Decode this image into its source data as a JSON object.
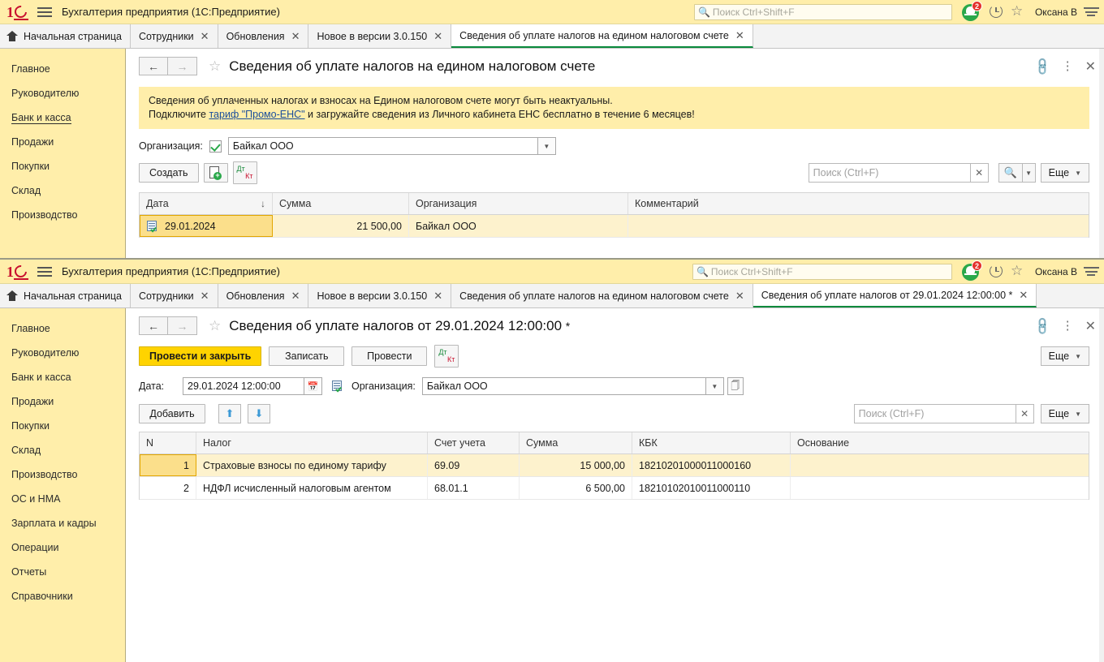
{
  "app": {
    "title": "Бухгалтерия предприятия  (1С:Предприятие)",
    "user": "Оксана В",
    "notification_count": "2",
    "global_search_placeholder": "Поиск Ctrl+Shift+F",
    "accent_green": "#0a8a3c",
    "title_bg": "#ffeeaa",
    "sidebar_bg": "#ffeeaa",
    "primary_btn": "#ffd300"
  },
  "window1": {
    "tabs": [
      {
        "label": "Начальная страница",
        "closable": false,
        "active": false
      },
      {
        "label": "Сотрудники",
        "closable": true,
        "active": false
      },
      {
        "label": "Обновления",
        "closable": true,
        "active": false
      },
      {
        "label": "Новое в версии 3.0.150",
        "closable": true,
        "active": false
      },
      {
        "label": "Сведения об уплате налогов на едином налоговом счете",
        "closable": true,
        "active": true
      }
    ],
    "sidebar": [
      {
        "label": "Главное",
        "active": false
      },
      {
        "label": "Руководителю",
        "active": false
      },
      {
        "label": "Банк и касса",
        "active": true
      },
      {
        "label": "Продажи",
        "active": false
      },
      {
        "label": "Покупки",
        "active": false
      },
      {
        "label": "Склад",
        "active": false
      },
      {
        "label": "Производство",
        "active": false
      }
    ],
    "doc_title": "Сведения об уплате налогов на едином налоговом счете",
    "banner_line1": "Сведения об уплаченных налогах и взносах на Едином налоговом счете могут быть неактуальны.",
    "banner_prefix": "Подключите ",
    "banner_link": "тариф \"Промо-ЕНС\"",
    "banner_suffix": " и загружайте сведения из Личного кабинета ЕНС бесплатно в течение 6 месяцев!",
    "org_label": "Организация:",
    "org_value": "Байкал ООО",
    "create_label": "Создать",
    "search_placeholder": "Поиск (Ctrl+F)",
    "more_label": "Еще",
    "table": {
      "columns": [
        "Дата",
        "Сумма",
        "Организация",
        "Комментарий"
      ],
      "sort_column": "Дата",
      "rows": [
        {
          "Дата": "29.01.2024",
          "Сумма": "21 500,00",
          "Организация": "Байкал ООО",
          "Комментарий": ""
        }
      ]
    }
  },
  "window2": {
    "tabs": [
      {
        "label": "Начальная страница",
        "closable": false,
        "active": false
      },
      {
        "label": "Сотрудники",
        "closable": true,
        "active": false
      },
      {
        "label": "Обновления",
        "closable": true,
        "active": false
      },
      {
        "label": "Новое в версии 3.0.150",
        "closable": true,
        "active": false
      },
      {
        "label": "Сведения об уплате налогов на едином налоговом счете",
        "closable": true,
        "active": false
      },
      {
        "label": "Сведения об уплате налогов от 29.01.2024 12:00:00 *",
        "closable": true,
        "active": true
      }
    ],
    "sidebar": [
      {
        "label": "Главное",
        "active": false
      },
      {
        "label": "Руководителю",
        "active": false
      },
      {
        "label": "Банк и касса",
        "active": false
      },
      {
        "label": "Продажи",
        "active": false
      },
      {
        "label": "Покупки",
        "active": false
      },
      {
        "label": "Склад",
        "active": false
      },
      {
        "label": "Производство",
        "active": false
      },
      {
        "label": "ОС и НМА",
        "active": false
      },
      {
        "label": "Зарплата и кадры",
        "active": false
      },
      {
        "label": "Операции",
        "active": false
      },
      {
        "label": "Отчеты",
        "active": false
      },
      {
        "label": "Справочники",
        "active": false
      }
    ],
    "doc_title": "Сведения об уплате налогов от 29.01.2024 12:00:00",
    "doc_title_modified": "*",
    "buttons": {
      "post_and_close": "Провести и закрыть",
      "write": "Записать",
      "post": "Провести",
      "more": "Еще",
      "add": "Добавить"
    },
    "date_label": "Дата:",
    "date_value": "29.01.2024 12:00:00",
    "org_label": "Организация:",
    "org_value": "Байкал ООО",
    "search_placeholder": "Поиск (Ctrl+F)",
    "table": {
      "columns": [
        "N",
        "Налог",
        "Счет учета",
        "Сумма",
        "КБК",
        "Основание"
      ],
      "rows": [
        {
          "N": "1",
          "Налог": "Страховые взносы по единому тарифу",
          "Счет учета": "69.09",
          "Сумма": "15 000,00",
          "КБК": "18210201000011000160",
          "Основание": "",
          "selected": true
        },
        {
          "N": "2",
          "Налог": "НДФЛ исчисленный налоговым агентом",
          "Счет учета": "68.01.1",
          "Сумма": "6 500,00",
          "КБК": "18210102010011000110",
          "Основание": "",
          "selected": false
        }
      ]
    }
  }
}
